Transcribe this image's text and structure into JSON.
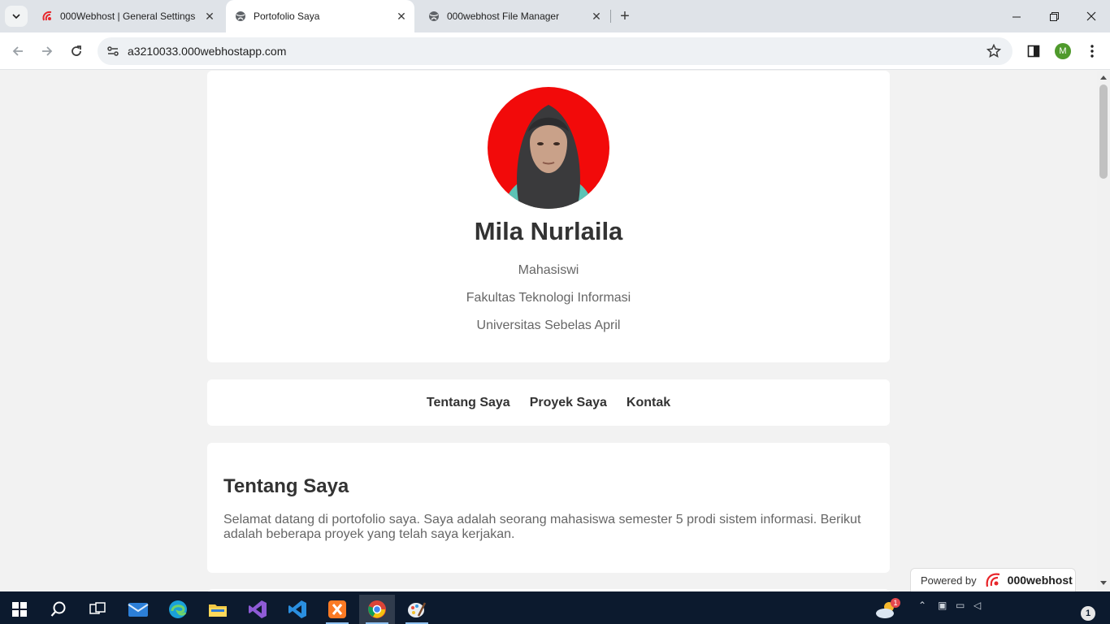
{
  "browser": {
    "tabs": [
      {
        "title": "000Webhost | General Settings",
        "icon": "000webhost-logo-icon",
        "active": false
      },
      {
        "title": "Portofolio Saya",
        "icon": "globe-icon",
        "active": true
      },
      {
        "title": "000webhost File Manager",
        "icon": "globe-icon",
        "active": false
      }
    ],
    "url": "a3210033.000webhostapp.com",
    "profile_initial": "M"
  },
  "profile": {
    "name": "Mila Nurlaila",
    "role": "Mahasiswi",
    "faculty": "Fakultas Teknologi Informasi",
    "university": "Universitas Sebelas April"
  },
  "nav": {
    "items": [
      "Tentang Saya",
      "Proyek Saya",
      "Kontak"
    ]
  },
  "about": {
    "heading": "Tentang Saya",
    "text": "Selamat datang di portofolio saya. Saya adalah seorang mahasiswa semester 5 prodi sistem informasi. Berikut adalah beberapa proyek yang telah saya kerjakan."
  },
  "badge": {
    "prefix": "Powered by",
    "brand": "000webhost"
  },
  "taskbar": {
    "apps": [
      "start-icon",
      "search-icon",
      "task-view-icon",
      "mail-icon",
      "edge-icon",
      "file-explorer-icon",
      "visual-studio-icon",
      "vscode-icon",
      "xampp-icon",
      "chrome-icon",
      "paint-icon"
    ],
    "weather_badge": "1",
    "notification_count": "1"
  },
  "colors": {
    "accent_red": "#e8262b",
    "page_bg": "#f2f2f2",
    "taskbar_bg": "#0c1a2e"
  }
}
